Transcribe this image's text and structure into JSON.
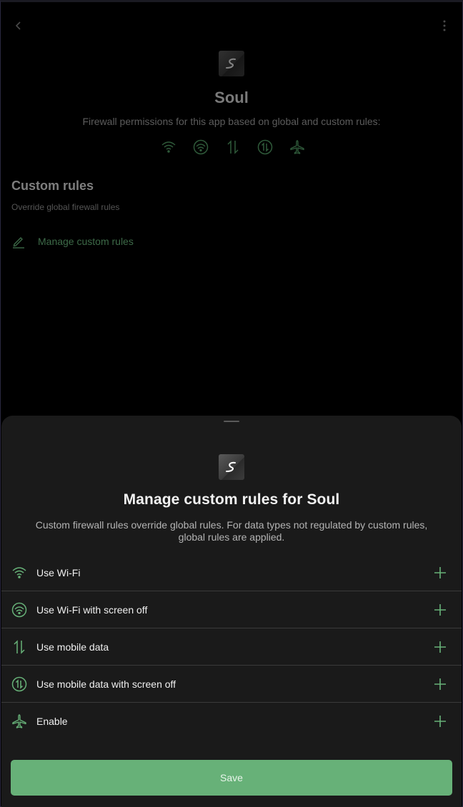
{
  "app": {
    "name": "Soul",
    "icon": "soul-app-icon"
  },
  "background_page": {
    "description": "Firewall permissions for this app based on global and custom rules:",
    "permission_icons": [
      "wifi-icon",
      "wifi-screen-off-icon",
      "mobile-data-icon",
      "mobile-data-screen-off-icon",
      "airplane-icon"
    ],
    "section_title": "Custom rules",
    "section_subtitle": "Override global firewall rules",
    "manage_label": "Manage custom rules"
  },
  "sheet": {
    "title": "Manage custom rules for Soul",
    "description": "Custom firewall rules override global rules. For data types not regulated by custom rules, global rules are applied.",
    "rules": [
      {
        "label": "Use Wi-Fi",
        "icon": "wifi-icon"
      },
      {
        "label": "Use Wi-Fi with screen off",
        "icon": "wifi-screen-off-icon"
      },
      {
        "label": "Use mobile data",
        "icon": "mobile-data-icon"
      },
      {
        "label": "Use mobile data with screen off",
        "icon": "mobile-data-screen-off-icon"
      },
      {
        "label": "Enable",
        "icon": "airplane-icon"
      }
    ],
    "save_label": "Save"
  },
  "colors": {
    "accent": "#67b178",
    "accent_dim": "#3d6a48",
    "sheet_bg": "#1a1a1a"
  }
}
